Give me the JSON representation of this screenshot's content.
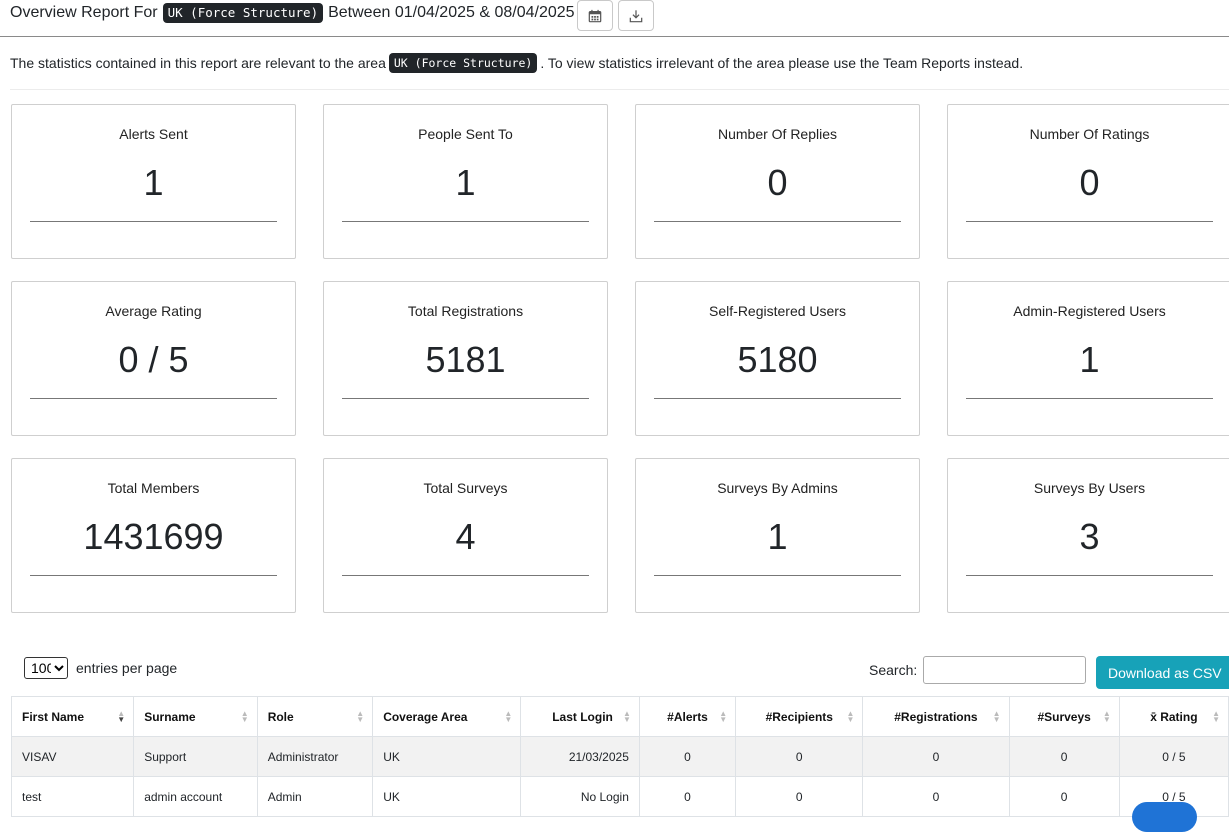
{
  "header": {
    "title_prefix": "Overview Report For",
    "area": "UK (Force Structure)",
    "title_between": "Between 01/04/2025 & 08/04/2025",
    "calendar_icon": "calendar-icon",
    "download_icon": "download-icon"
  },
  "intro": {
    "before": "The statistics contained in this report are relevant to the area",
    "area": "UK (Force Structure)",
    "after": ". To view statistics irrelevant of the area please use the Team Reports instead."
  },
  "stats": [
    {
      "label": "Alerts Sent",
      "value": "1"
    },
    {
      "label": "People Sent To",
      "value": "1"
    },
    {
      "label": "Number Of Replies",
      "value": "0"
    },
    {
      "label": "Number Of Ratings",
      "value": "0"
    },
    {
      "label": "Average Rating",
      "value": "0 / 5"
    },
    {
      "label": "Total Registrations",
      "value": "5181"
    },
    {
      "label": "Self-Registered Users",
      "value": "5180"
    },
    {
      "label": "Admin-Registered Users",
      "value": "1"
    },
    {
      "label": "Total Members",
      "value": "1431699"
    },
    {
      "label": "Total Surveys",
      "value": "4"
    },
    {
      "label": "Surveys By Admins",
      "value": "1"
    },
    {
      "label": "Surveys By Users",
      "value": "3"
    }
  ],
  "table_controls": {
    "entries_value": "100",
    "entries_label": "entries per page",
    "search_label": "Search:",
    "search_value": "",
    "csv_label": "Download as CSV"
  },
  "table": {
    "columns": [
      "First Name",
      "Surname",
      "Role",
      "Coverage Area",
      "Last Login",
      "#Alerts",
      "#Recipients",
      "#Registrations",
      "#Surveys",
      "x̄ Rating"
    ],
    "rows": [
      [
        "VISAV",
        "Support",
        "Administrator",
        "UK",
        "21/03/2025",
        "0",
        "0",
        "0",
        "0",
        "0 / 5"
      ],
      [
        "test",
        "admin account",
        "Admin",
        "UK",
        "No Login",
        "0",
        "0",
        "0",
        "0",
        "0 / 5"
      ]
    ]
  },
  "colors": {
    "accent": "#17a2b8",
    "badge_bg": "#212529",
    "chat": "#1f73d6"
  }
}
